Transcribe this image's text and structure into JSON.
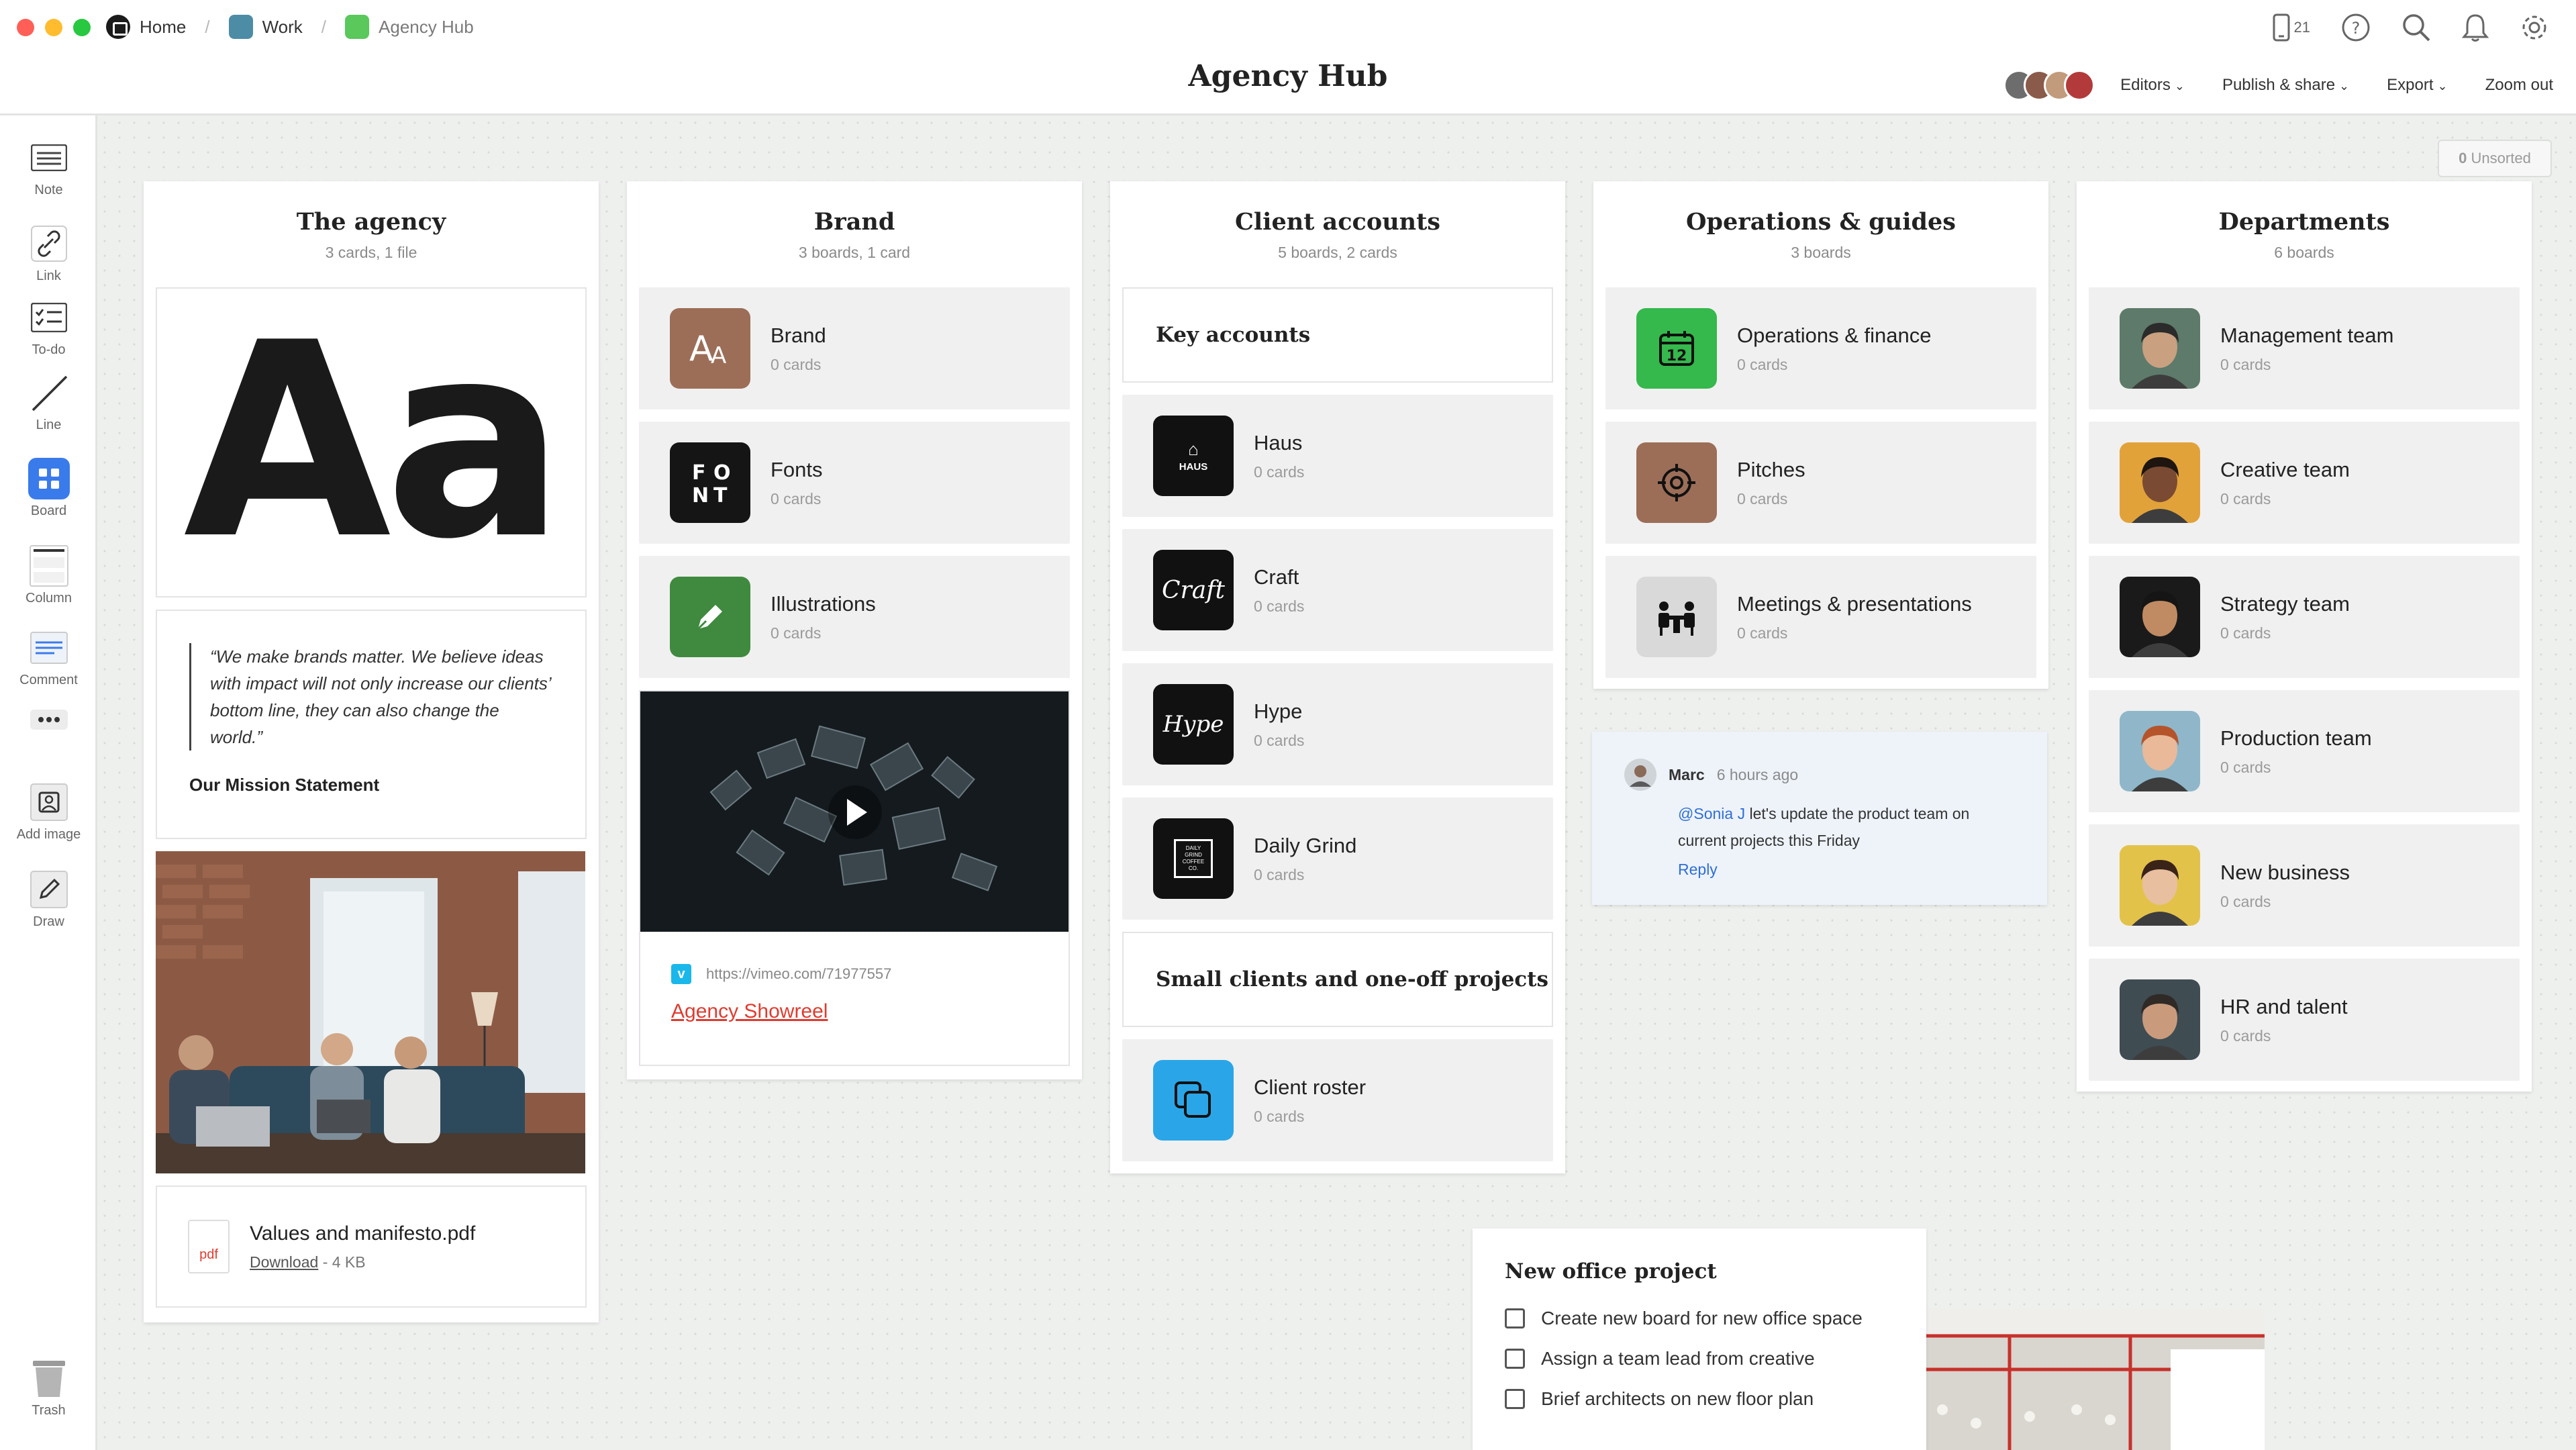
{
  "window": {
    "traffic_colors": [
      "#ff5f57",
      "#febc2e",
      "#28c840"
    ]
  },
  "breadcrumb": {
    "items": [
      {
        "label": "Home",
        "icon": "home-icon",
        "color": "#1b1b1b"
      },
      {
        "label": "Work",
        "icon": "board-icon",
        "color": "#4d8ca5"
      },
      {
        "label": "Agency Hub",
        "icon": "board-icon",
        "color": "#5ac85a"
      }
    ]
  },
  "header": {
    "title": "Agency Hub",
    "device_count": "21",
    "actions": {
      "editors": "Editors",
      "publish": "Publish & share",
      "export": "Export",
      "zoom": "Zoom out"
    }
  },
  "toolbar": {
    "tools": [
      {
        "label": "Note",
        "icon": "note-icon"
      },
      {
        "label": "Link",
        "icon": "link-icon"
      },
      {
        "label": "To-do",
        "icon": "todo-icon"
      },
      {
        "label": "Line",
        "icon": "line-icon"
      },
      {
        "label": "Board",
        "icon": "board-icon"
      },
      {
        "label": "Column",
        "icon": "column-icon"
      },
      {
        "label": "Comment",
        "icon": "comment-icon"
      },
      {
        "label": "",
        "icon": "more-icon"
      },
      {
        "label": "Add image",
        "icon": "image-icon"
      },
      {
        "label": "Draw",
        "icon": "pen-icon"
      },
      {
        "label": "Trash",
        "icon": "trash-icon"
      }
    ]
  },
  "canvas": {
    "unsorted_count": "0",
    "unsorted_label": "Unsorted"
  },
  "agency": {
    "title": "The agency",
    "subtitle": "3 cards, 1 file",
    "typeface_sample": "Aa",
    "quote": "“We make brands matter. We believe ideas with impact will not only increase our clients’ bottom line, they can also change the world.”",
    "quote_caption": "Our Mission Statement",
    "file": {
      "name": "Values and manifesto.pdf",
      "type_label": "pdf",
      "download": "Download",
      "size": "- 4 KB"
    }
  },
  "brand": {
    "title": "Brand",
    "subtitle": "3 boards, 1 card",
    "boards": [
      {
        "name": "Brand",
        "count": "0 cards",
        "color": "#9c6e58",
        "icon": "brand-font-icon"
      },
      {
        "name": "Fonts",
        "count": "0 cards",
        "color": "#151515",
        "icon": "font-icon"
      },
      {
        "name": "Illustrations",
        "count": "0 cards",
        "color": "#3f8a3e",
        "icon": "pen-icon"
      }
    ],
    "video": {
      "url": "https://vimeo.com/71977557",
      "link_text": "Agency Showreel"
    }
  },
  "clients": {
    "title": "Client accounts",
    "subtitle": "5 boards, 2 cards",
    "key_heading": "Key accounts",
    "boards": [
      {
        "name": "Haus",
        "count": "0 cards",
        "logo": "HAUS"
      },
      {
        "name": "Craft",
        "count": "0 cards",
        "logo": "Craft"
      },
      {
        "name": "Hype",
        "count": "0 cards",
        "logo": "Hype"
      },
      {
        "name": "Daily Grind",
        "count": "0 cards",
        "logo": "DAILY GRIND COFFEE CO."
      }
    ],
    "small_heading": "Small clients and one-off projects",
    "roster": {
      "name": "Client roster",
      "count": "0 cards",
      "color": "#2aa6e8"
    }
  },
  "operations": {
    "title": "Operations & guides",
    "subtitle": "3 boards",
    "boards": [
      {
        "name": "Operations & finance",
        "count": "0 cards",
        "color": "#35b84c",
        "icon": "calendar-icon",
        "calendar_day": "12"
      },
      {
        "name": "Pitches",
        "count": "0 cards",
        "color": "#9c6e58",
        "icon": "target-icon"
      },
      {
        "name": "Meetings & presentations",
        "count": "0 cards",
        "color": "#d9d9d9",
        "icon": "meeting-icon"
      }
    ]
  },
  "comment": {
    "author": "Marc",
    "time": "6 hours ago",
    "mention": "@Sonia J",
    "text": " let's update the product team on current projects this Friday",
    "reply": "Reply"
  },
  "departments": {
    "title": "Departments",
    "subtitle": "6 boards",
    "boards": [
      {
        "name": "Management team",
        "count": "0 cards",
        "bg": "#5d7a6a",
        "skin": "#c9a080",
        "hair": "#2b2b2b"
      },
      {
        "name": "Creative team",
        "count": "0 cards",
        "bg": "#e2a23a",
        "skin": "#7a4b32",
        "hair": "#1e1510"
      },
      {
        "name": "Strategy team",
        "count": "0 cards",
        "bg": "#1a1a1a",
        "skin": "#c08b62",
        "hair": "#151515"
      },
      {
        "name": "Production team",
        "count": "0 cards",
        "bg": "#8fb7c9",
        "skin": "#e9b99a",
        "hair": "#b5542b"
      },
      {
        "name": "New business",
        "count": "0 cards",
        "bg": "#e3c24a",
        "skin": "#e8bf9f",
        "hair": "#3a2418"
      },
      {
        "name": "HR and talent",
        "count": "0 cards",
        "bg": "#3f4c52",
        "skin": "#c99b7c",
        "hair": "#2f2a26"
      }
    ]
  },
  "todo": {
    "title": "New office project",
    "items": [
      {
        "text": "Create new board for new office space",
        "done": false
      },
      {
        "text": "Assign a team lead from creative",
        "done": false
      },
      {
        "text": "Brief architects on new floor plan",
        "done": false
      }
    ]
  }
}
